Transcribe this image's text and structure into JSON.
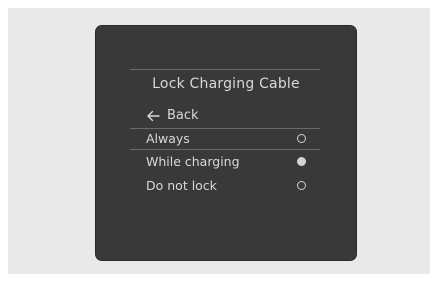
{
  "screen": {
    "title": "Lock Charging Cable",
    "back_label": "Back",
    "options": [
      {
        "label": "Always",
        "selected": false
      },
      {
        "label": "While charging",
        "selected": true
      },
      {
        "label": "Do not lock",
        "selected": false
      }
    ]
  }
}
